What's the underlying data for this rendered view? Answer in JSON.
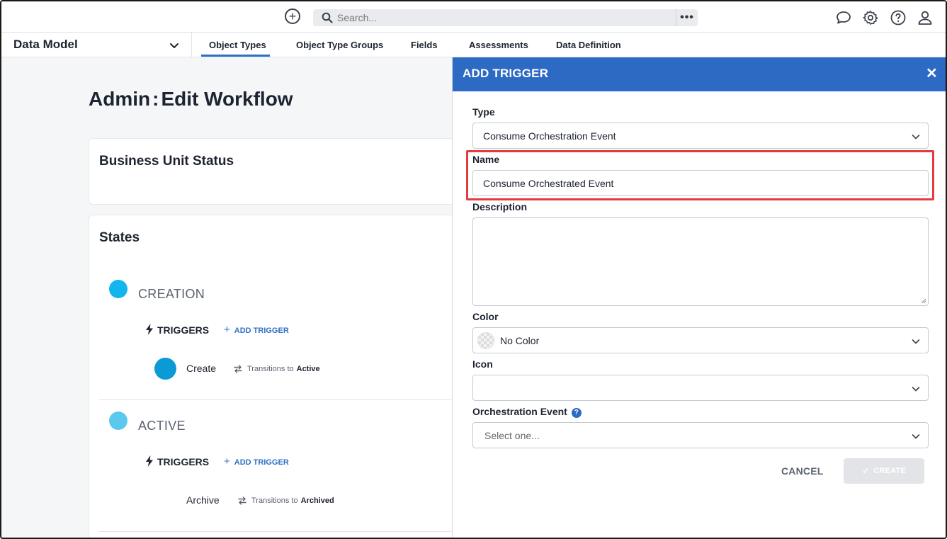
{
  "topbar": {
    "add_icon": "plus-circle-icon",
    "search_placeholder": "Search...",
    "more_label": "•••",
    "icons": [
      "chat-icon",
      "gear-icon",
      "help-icon",
      "user-icon"
    ]
  },
  "navbar": {
    "module_title": "Data Model",
    "tabs": [
      {
        "label": "Object Types",
        "active": true
      },
      {
        "label": "Object Type Groups"
      },
      {
        "label": "Fields"
      },
      {
        "label": "Assessments"
      },
      {
        "label": "Data Definition"
      }
    ]
  },
  "page": {
    "title_left": "Admin",
    "title_sep": ":",
    "title_right": "Edit Workflow",
    "workflow_name": "Business Unit Status",
    "states_heading": "States",
    "states": [
      {
        "name": "CREATION",
        "color": "#12b5ee",
        "triggers_label": "TRIGGERS",
        "add_trigger_label": "ADD TRIGGER",
        "triggers": [
          {
            "name": "Create",
            "transition_prefix": "Transitions to",
            "target": "Active",
            "color": "#0c9ad6"
          }
        ]
      },
      {
        "name": "ACTIVE",
        "color": "#5bc8ef",
        "triggers_label": "TRIGGERS",
        "add_trigger_label": "ADD TRIGGER",
        "triggers": [
          {
            "name": "Archive",
            "transition_prefix": "Transitions to",
            "target": "Archived"
          }
        ]
      }
    ]
  },
  "drawer": {
    "title": "ADD TRIGGER",
    "close_label": "✕",
    "type_label": "Type",
    "type_value": "Consume Orchestration Event",
    "name_label": "Name",
    "name_value": "Consume Orchestrated Event",
    "description_label": "Description",
    "description_value": "",
    "color_label": "Color",
    "color_value": "No Color",
    "icon_label": "Icon",
    "icon_value": "",
    "orchestration_label": "Orchestration Event",
    "orchestration_help": "?",
    "orchestration_placeholder": "Select one...",
    "cancel_label": "CANCEL",
    "create_label": "CREATE",
    "colors": {
      "header": "#2c6ac4",
      "highlight": "#e33b3f",
      "create_disabled": "#e2e4e7"
    }
  }
}
